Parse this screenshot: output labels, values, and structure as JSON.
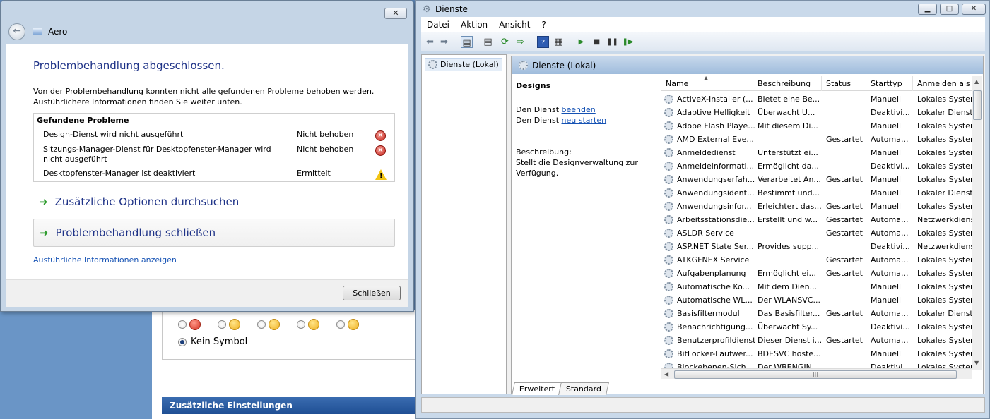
{
  "background": {
    "kein_symbol_label": "Kein Symbol",
    "zusatz_label": "Zusätzliche Einstellungen"
  },
  "troubleshooter": {
    "title": "Aero",
    "close_glyph": "✕",
    "heading": "Problembehandlung abgeschlossen.",
    "description": "Von der Problembehandlung konnten nicht alle gefundenen Probleme behoben werden. Ausführlichere Informationen finden Sie weiter unten.",
    "problems_header": "Gefundene Probleme",
    "problems": [
      {
        "name": "Design-Dienst wird nicht ausgeführt",
        "status": "Nicht behoben",
        "icon": "error-icon"
      },
      {
        "name": "Sitzungs-Manager-Dienst für Desktopfenster-Manager wird nicht ausgeführt",
        "status": "Nicht behoben",
        "icon": "error-icon"
      },
      {
        "name": "Desktopfenster-Manager ist deaktiviert",
        "status": "Ermittelt",
        "icon": "warning-icon"
      }
    ],
    "option_browse": "Zusätzliche Optionen durchsuchen",
    "option_close": "Problembehandlung schließen",
    "details_link": "Ausführliche Informationen anzeigen",
    "close_button": "Schließen"
  },
  "services": {
    "title": "Dienste",
    "window_buttons": {
      "minimize": "▁",
      "maximize": "□",
      "close": "✕"
    },
    "menu": [
      "Datei",
      "Aktion",
      "Ansicht",
      "?"
    ],
    "tree_item": "Dienste (Lokal)",
    "pane_header": "Dienste (Lokal)",
    "detail": {
      "title": "Designs",
      "stop_prefix": "Den Dienst",
      "stop_link": "beenden",
      "restart_prefix": "Den Dienst",
      "restart_link": "neu starten",
      "desc_label": "Beschreibung:",
      "desc_text": "Stellt die Designverwaltung zur Verfügung."
    },
    "columns": [
      "Name",
      "Beschreibung",
      "Status",
      "Starttyp",
      "Anmelden als"
    ],
    "rows": [
      [
        "ActiveX-Installer (...",
        "Bietet eine Be...",
        "",
        "Manuell",
        "Lokales System"
      ],
      [
        "Adaptive Helligkeit",
        "Überwacht U...",
        "",
        "Deaktivi...",
        "Lokaler Dienst"
      ],
      [
        "Adobe Flash Playe...",
        "Mit diesem Di...",
        "",
        "Manuell",
        "Lokales System"
      ],
      [
        "AMD External Eve...",
        "",
        "Gestartet",
        "Automa...",
        "Lokales System"
      ],
      [
        "Anmeldedienst",
        "Unterstützt ei...",
        "",
        "Manuell",
        "Lokales System"
      ],
      [
        "Anmeldeinformati...",
        "Ermöglicht da...",
        "",
        "Deaktivi...",
        "Lokales System"
      ],
      [
        "Anwendungserfah...",
        "Verarbeitet An...",
        "Gestartet",
        "Manuell",
        "Lokales System"
      ],
      [
        "Anwendungsident...",
        "Bestimmt und...",
        "",
        "Manuell",
        "Lokaler Dienst"
      ],
      [
        "Anwendungsinfor...",
        "Erleichtert das...",
        "Gestartet",
        "Manuell",
        "Lokales System"
      ],
      [
        "Arbeitsstationsdie...",
        "Erstellt und w...",
        "Gestartet",
        "Automa...",
        "Netzwerkdienst"
      ],
      [
        "ASLDR Service",
        "",
        "Gestartet",
        "Automa...",
        "Lokales System"
      ],
      [
        "ASP.NET State Ser...",
        "Provides supp...",
        "",
        "Deaktivi...",
        "Netzwerkdienst"
      ],
      [
        "ATKGFNEX Service",
        "",
        "Gestartet",
        "Automa...",
        "Lokales System"
      ],
      [
        "Aufgabenplanung",
        "Ermöglicht ei...",
        "Gestartet",
        "Automa...",
        "Lokales System"
      ],
      [
        "Automatische Ko...",
        "Mit dem Dien...",
        "",
        "Manuell",
        "Lokales System"
      ],
      [
        "Automatische WL...",
        "Der WLANSVC...",
        "",
        "Manuell",
        "Lokales System"
      ],
      [
        "Basisfiltermodul",
        "Das Basisfilter...",
        "Gestartet",
        "Automa...",
        "Lokaler Dienst"
      ],
      [
        "Benachrichtigung...",
        "Überwacht Sy...",
        "",
        "Deaktivi...",
        "Lokales System"
      ],
      [
        "Benutzerprofildienst",
        "Dieser Dienst i...",
        "Gestartet",
        "Automa...",
        "Lokales System"
      ],
      [
        "BitLocker-Laufwer...",
        "BDESVC hoste...",
        "",
        "Manuell",
        "Lokales System"
      ],
      [
        "Blockebenen-Sich...",
        "Der WBENGIN...",
        "",
        "Deaktivi...",
        "Lokales System"
      ]
    ],
    "tabs": [
      "Erweitert",
      "Standard"
    ]
  }
}
